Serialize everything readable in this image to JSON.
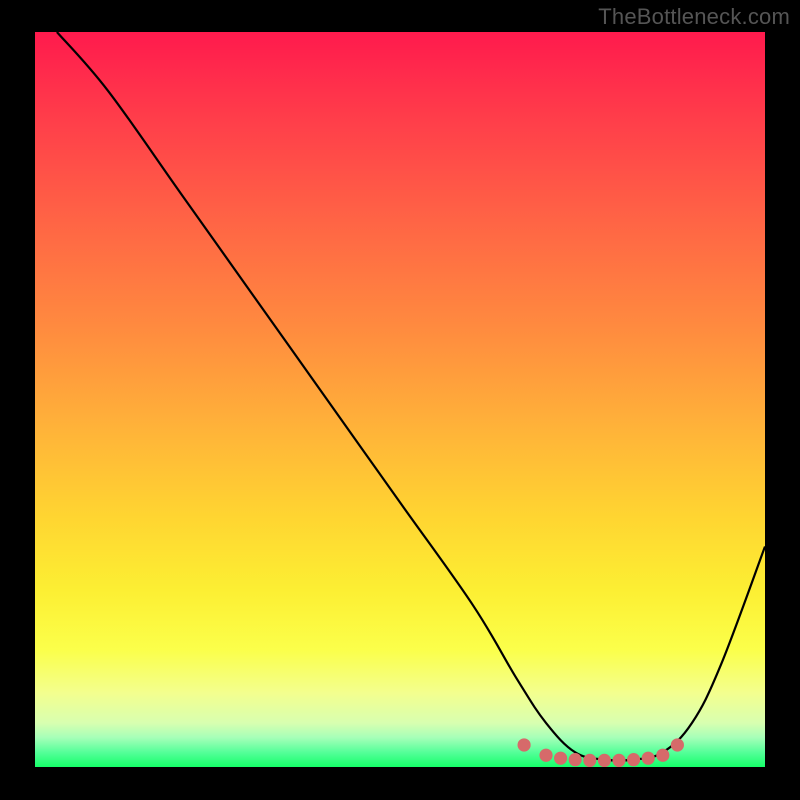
{
  "watermark": "TheBottleneck.com",
  "chart_data": {
    "type": "line",
    "title": "",
    "xlabel": "",
    "ylabel": "",
    "xlim": [
      0,
      100
    ],
    "ylim": [
      0,
      100
    ],
    "grid": false,
    "series": [
      {
        "name": "curve",
        "color": "#000000",
        "x": [
          3,
          10,
          20,
          30,
          40,
          50,
          60,
          66,
          70,
          74,
          78,
          82,
          86,
          90,
          94,
          100
        ],
        "y": [
          100,
          92,
          78,
          64,
          50,
          36,
          22,
          12,
          6,
          2,
          1,
          1,
          2,
          6,
          14,
          30
        ]
      },
      {
        "name": "markers",
        "color": "#d66a6a",
        "type": "scatter",
        "x": [
          67,
          70,
          72,
          74,
          76,
          78,
          80,
          82,
          84,
          86,
          88
        ],
        "y": [
          3.0,
          1.6,
          1.2,
          1.0,
          0.9,
          0.9,
          0.9,
          1.0,
          1.2,
          1.6,
          3.0
        ]
      }
    ],
    "gradient_stops": [
      {
        "pos": 0,
        "color": "#ff1a4d"
      },
      {
        "pos": 12,
        "color": "#ff3e4a"
      },
      {
        "pos": 26,
        "color": "#ff6545"
      },
      {
        "pos": 40,
        "color": "#ff8a3f"
      },
      {
        "pos": 54,
        "color": "#ffb339"
      },
      {
        "pos": 66,
        "color": "#ffd531"
      },
      {
        "pos": 76,
        "color": "#fcef33"
      },
      {
        "pos": 84,
        "color": "#fbff4a"
      },
      {
        "pos": 90,
        "color": "#f3ff8f"
      },
      {
        "pos": 94,
        "color": "#d8ffb0"
      },
      {
        "pos": 96,
        "color": "#a6ffb8"
      },
      {
        "pos": 98,
        "color": "#55ff99"
      },
      {
        "pos": 100,
        "color": "#15ff69"
      }
    ]
  }
}
